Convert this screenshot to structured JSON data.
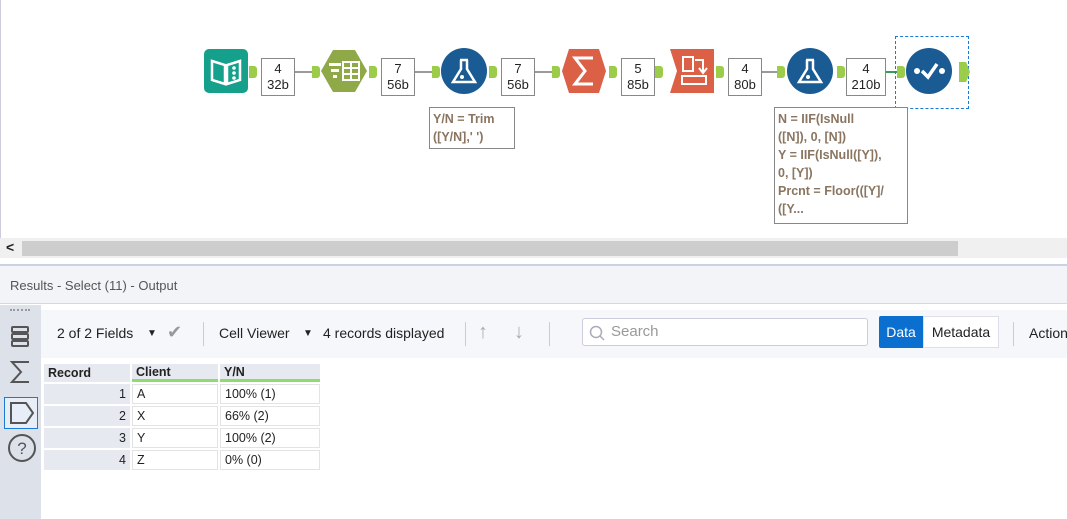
{
  "workflow": {
    "connections": [
      {
        "count": "4",
        "size": "32b"
      },
      {
        "count": "7",
        "size": "56b"
      },
      {
        "count": "7",
        "size": "56b"
      },
      {
        "count": "5",
        "size": "85b"
      },
      {
        "count": "4",
        "size": "80b"
      },
      {
        "count": "4",
        "size": "210b"
      }
    ],
    "annotations": {
      "formula1": [
        "Y/N = Trim",
        "([Y/N],' ')"
      ],
      "formula2": [
        "N = IIF(IsNull",
        "([N]), 0, [N])",
        "Y = IIF(IsNull([Y]),",
        "0, [Y])",
        "Prcnt = Floor(([Y]/",
        "([Y..."
      ]
    }
  },
  "scroll_left": "<",
  "results": {
    "title": "Results - Select (11) - Output",
    "toolbar": {
      "fields": "2 of 2 Fields",
      "cell_viewer": "Cell Viewer",
      "records": "4 records displayed",
      "search_placeholder": "Search",
      "data": "Data",
      "metadata": "Metadata",
      "actions": "Actions"
    },
    "columns": [
      "Record",
      "Client",
      "Y/N"
    ],
    "rows": [
      [
        "1",
        "A",
        "100% (1)"
      ],
      [
        "2",
        "X",
        "66% (2)"
      ],
      [
        "3",
        "Y",
        "100% (2)"
      ],
      [
        "4",
        "Z",
        "0% (0)"
      ]
    ]
  },
  "colors": {
    "accent": "#0b6fd0",
    "input": "#15a08c",
    "select": "#8fa848",
    "formula": "#1a5b94",
    "summarize": "#dc6046",
    "green": "#9ccd4a"
  }
}
